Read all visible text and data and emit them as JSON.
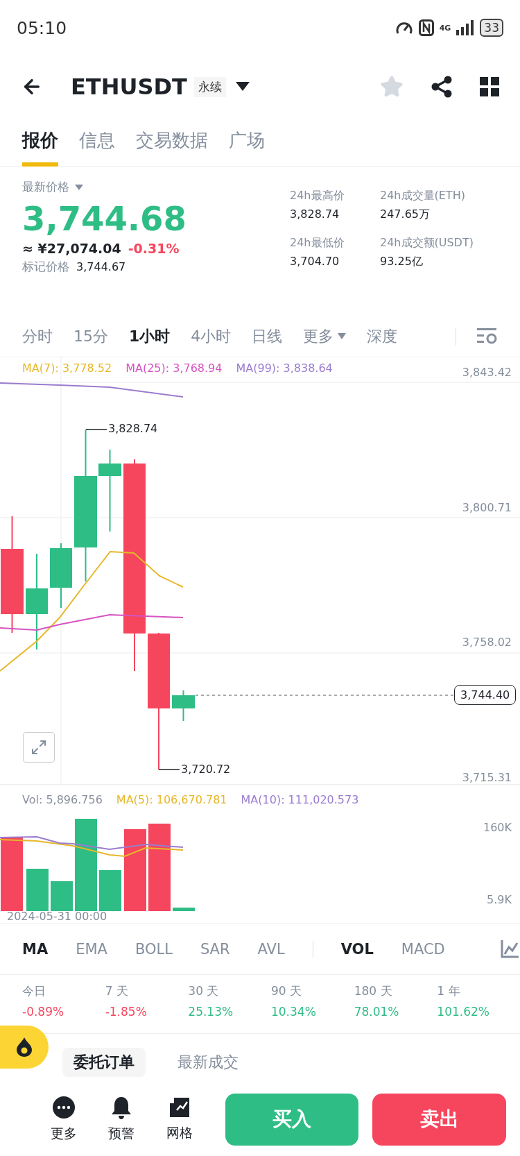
{
  "status_bar": {
    "time": "05:10",
    "network": "4G",
    "battery": "33"
  },
  "header": {
    "symbol": "ETHUSDT",
    "contract_type": "永续",
    "favorite": false
  },
  "tabs": [
    {
      "label": "报价",
      "selected": true
    },
    {
      "label": "信息",
      "selected": false
    },
    {
      "label": "交易数据",
      "selected": false
    },
    {
      "label": "广场",
      "selected": false
    }
  ],
  "price": {
    "label": "最新价格",
    "last": "3,744.68",
    "last_rising": true,
    "cny": "≈ ¥27,074.04",
    "change": "-0.31%",
    "change_rising": false,
    "mark_label": "标记价格",
    "mark": "3,744.67"
  },
  "stats": [
    {
      "label": "24h最高价",
      "value": "3,828.74"
    },
    {
      "label": "24h成交量(ETH)",
      "value": "247.65万"
    },
    {
      "label": "24h最低价",
      "value": "3,704.70"
    },
    {
      "label": "24h成交额(USDT)",
      "value": "93.25亿"
    }
  ],
  "intervals": [
    {
      "label": "分时",
      "selected": false,
      "dropdown": false
    },
    {
      "label": "15分",
      "selected": false,
      "dropdown": false
    },
    {
      "label": "1小时",
      "selected": true,
      "dropdown": false
    },
    {
      "label": "4小时",
      "selected": false,
      "dropdown": false
    },
    {
      "label": "日线",
      "selected": false,
      "dropdown": false
    },
    {
      "label": "更多",
      "selected": false,
      "dropdown": true
    },
    {
      "label": "深度",
      "selected": false,
      "dropdown": false
    }
  ],
  "chart": {
    "legend": [
      {
        "label": "MA(7): 3,778.52",
        "color": "#e6b72a"
      },
      {
        "label": "MA(25): 3,768.94",
        "color": "#d653c0"
      },
      {
        "label": "MA(99): 3,838.64",
        "color": "#9b7ccf"
      }
    ],
    "y_labels": [
      "3,843.42",
      "3,800.71",
      "3,758.02",
      "3,715.31"
    ],
    "high_label": "3,828.74",
    "low_label": "3,720.72",
    "current_price": "3,744.40"
  },
  "volume": {
    "legend": [
      {
        "label": "Vol: 5,896.756",
        "color": "#8a919c"
      },
      {
        "label": "MA(5): 106,670.781",
        "color": "#e6b72a"
      },
      {
        "label": "MA(10): 111,020.573",
        "color": "#9b7ccf"
      }
    ],
    "y_labels": [
      "160K",
      "5.9K"
    ],
    "date": "2024-05-31 00:00"
  },
  "indicators": [
    {
      "label": "MA",
      "selected": true,
      "divider_before": false
    },
    {
      "label": "EMA",
      "selected": false,
      "divider_before": false
    },
    {
      "label": "BOLL",
      "selected": false,
      "divider_before": false
    },
    {
      "label": "SAR",
      "selected": false,
      "divider_before": false
    },
    {
      "label": "AVL",
      "selected": false,
      "divider_before": false
    },
    {
      "label": "VOL",
      "selected": true,
      "divider_before": true
    },
    {
      "label": "MACD",
      "selected": false,
      "divider_before": false
    }
  ],
  "returns": [
    {
      "period": "今日",
      "value": "-0.89%",
      "rising": false
    },
    {
      "period": "7 天",
      "value": "-1.85%",
      "rising": false
    },
    {
      "period": "30 天",
      "value": "25.13%",
      "rising": true
    },
    {
      "period": "90 天",
      "value": "10.34%",
      "rising": true
    },
    {
      "period": "180 天",
      "value": "78.01%",
      "rising": true
    },
    {
      "period": "1 年",
      "value": "101.62%",
      "rising": true
    }
  ],
  "order_tabs": [
    {
      "label": "委托订单",
      "selected": true
    },
    {
      "label": "最新成交",
      "selected": false
    }
  ],
  "bottom_bar": {
    "actions": [
      {
        "label": "更多",
        "kind": "more"
      },
      {
        "label": "预警",
        "kind": "alert"
      },
      {
        "label": "网格",
        "kind": "grid"
      }
    ],
    "buy": "买入",
    "sell": "卖出"
  }
}
